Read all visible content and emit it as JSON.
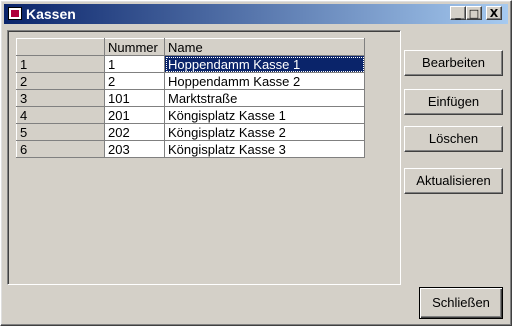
{
  "window": {
    "title": "Kassen"
  },
  "titlebar_buttons": {
    "minimize": "_",
    "maximize": "□",
    "close": "X"
  },
  "table": {
    "columns": [
      "",
      "Nummer",
      "Name"
    ],
    "rows": [
      {
        "index": "1",
        "nummer": "1",
        "name": "Hoppendamm Kasse 1",
        "selected": true
      },
      {
        "index": "2",
        "nummer": "2",
        "name": "Hoppendamm Kasse 2"
      },
      {
        "index": "3",
        "nummer": "101",
        "name": "Marktstraße"
      },
      {
        "index": "4",
        "nummer": "201",
        "name": "Köngisplatz Kasse 1"
      },
      {
        "index": "5",
        "nummer": "202",
        "name": "Köngisplatz Kasse 2"
      },
      {
        "index": "6",
        "nummer": "203",
        "name": "Köngisplatz Kasse 3"
      }
    ]
  },
  "buttons": {
    "edit": "Bearbeiten",
    "insert": "Einfügen",
    "delete": "Löschen",
    "refresh": "Aktualisieren",
    "close": "Schließen"
  },
  "colors": {
    "selection": "#0a246a",
    "titlebar_start": "#0a246a",
    "titlebar_end": "#a6caf0",
    "face": "#d4d0c8"
  }
}
